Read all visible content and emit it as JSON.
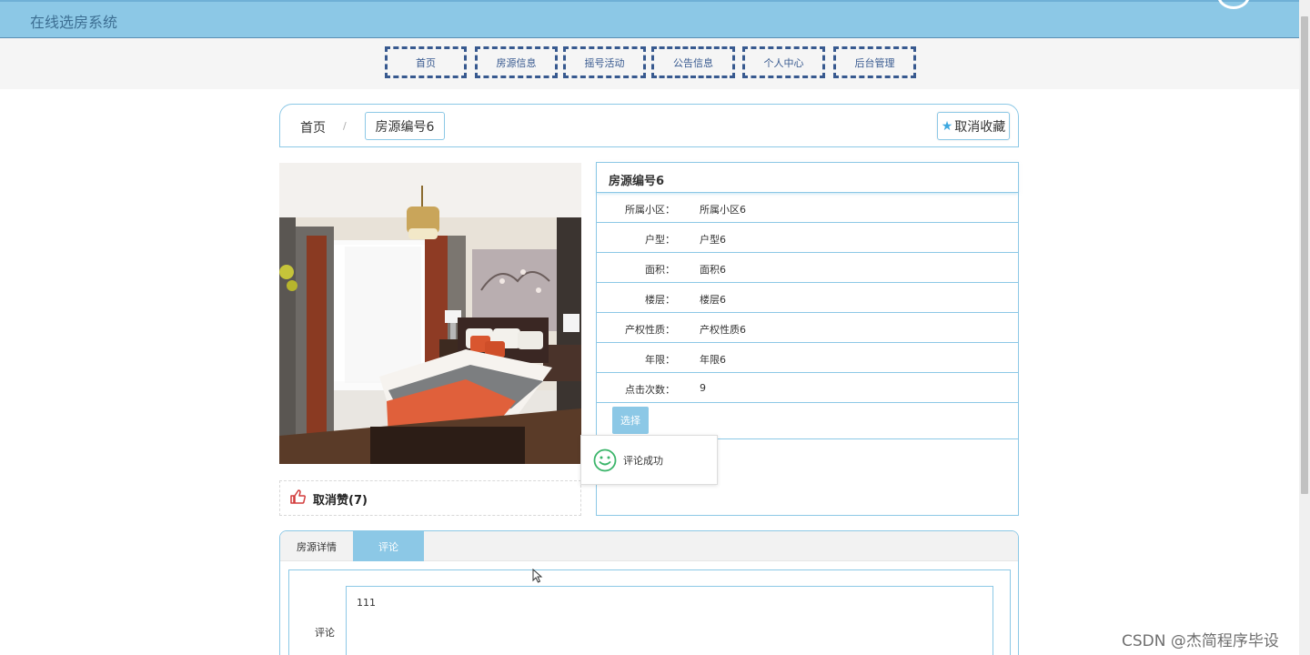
{
  "header": {
    "title": "在线选房系统"
  },
  "nav": {
    "items": [
      {
        "label": "首页"
      },
      {
        "label": "房源信息"
      },
      {
        "label": "摇号活动"
      },
      {
        "label": "公告信息"
      },
      {
        "label": "个人中心"
      },
      {
        "label": "后台管理"
      }
    ]
  },
  "breadcrumb": {
    "home": "首页",
    "separator": "/",
    "current": "房源编号6",
    "favorite_label": "取消收藏",
    "favorite_icon": "star-icon"
  },
  "like": {
    "label": "取消赞(7)",
    "icon": "thumbs-up-icon"
  },
  "detail": {
    "title": "房源编号6",
    "rows": [
      {
        "key": "所属小区：",
        "value": "所属小区6"
      },
      {
        "key": "户型：",
        "value": "户型6"
      },
      {
        "key": "面积：",
        "value": "面积6"
      },
      {
        "key": "楼层：",
        "value": "楼层6"
      },
      {
        "key": "产权性质：",
        "value": "产权性质6"
      },
      {
        "key": "年限：",
        "value": "年限6"
      },
      {
        "key": "点击次数：",
        "value": "9"
      }
    ],
    "select_label": "选择"
  },
  "toast": {
    "message": "评论成功",
    "icon": "smile-icon"
  },
  "tabs": {
    "items": [
      {
        "label": "房源详情",
        "active": false
      },
      {
        "label": "评论",
        "active": true
      }
    ]
  },
  "comment_form": {
    "label": "评论",
    "value": "111"
  },
  "watermark": "CSDN @杰简程序毕设",
  "colors": {
    "primary": "#8cc8e6",
    "nav_border": "#37598f",
    "title_text": "#3d6f93",
    "accent_star": "#3da8e0",
    "like_icon": "#d23b3b",
    "toast_icon": "#3bb56a"
  }
}
